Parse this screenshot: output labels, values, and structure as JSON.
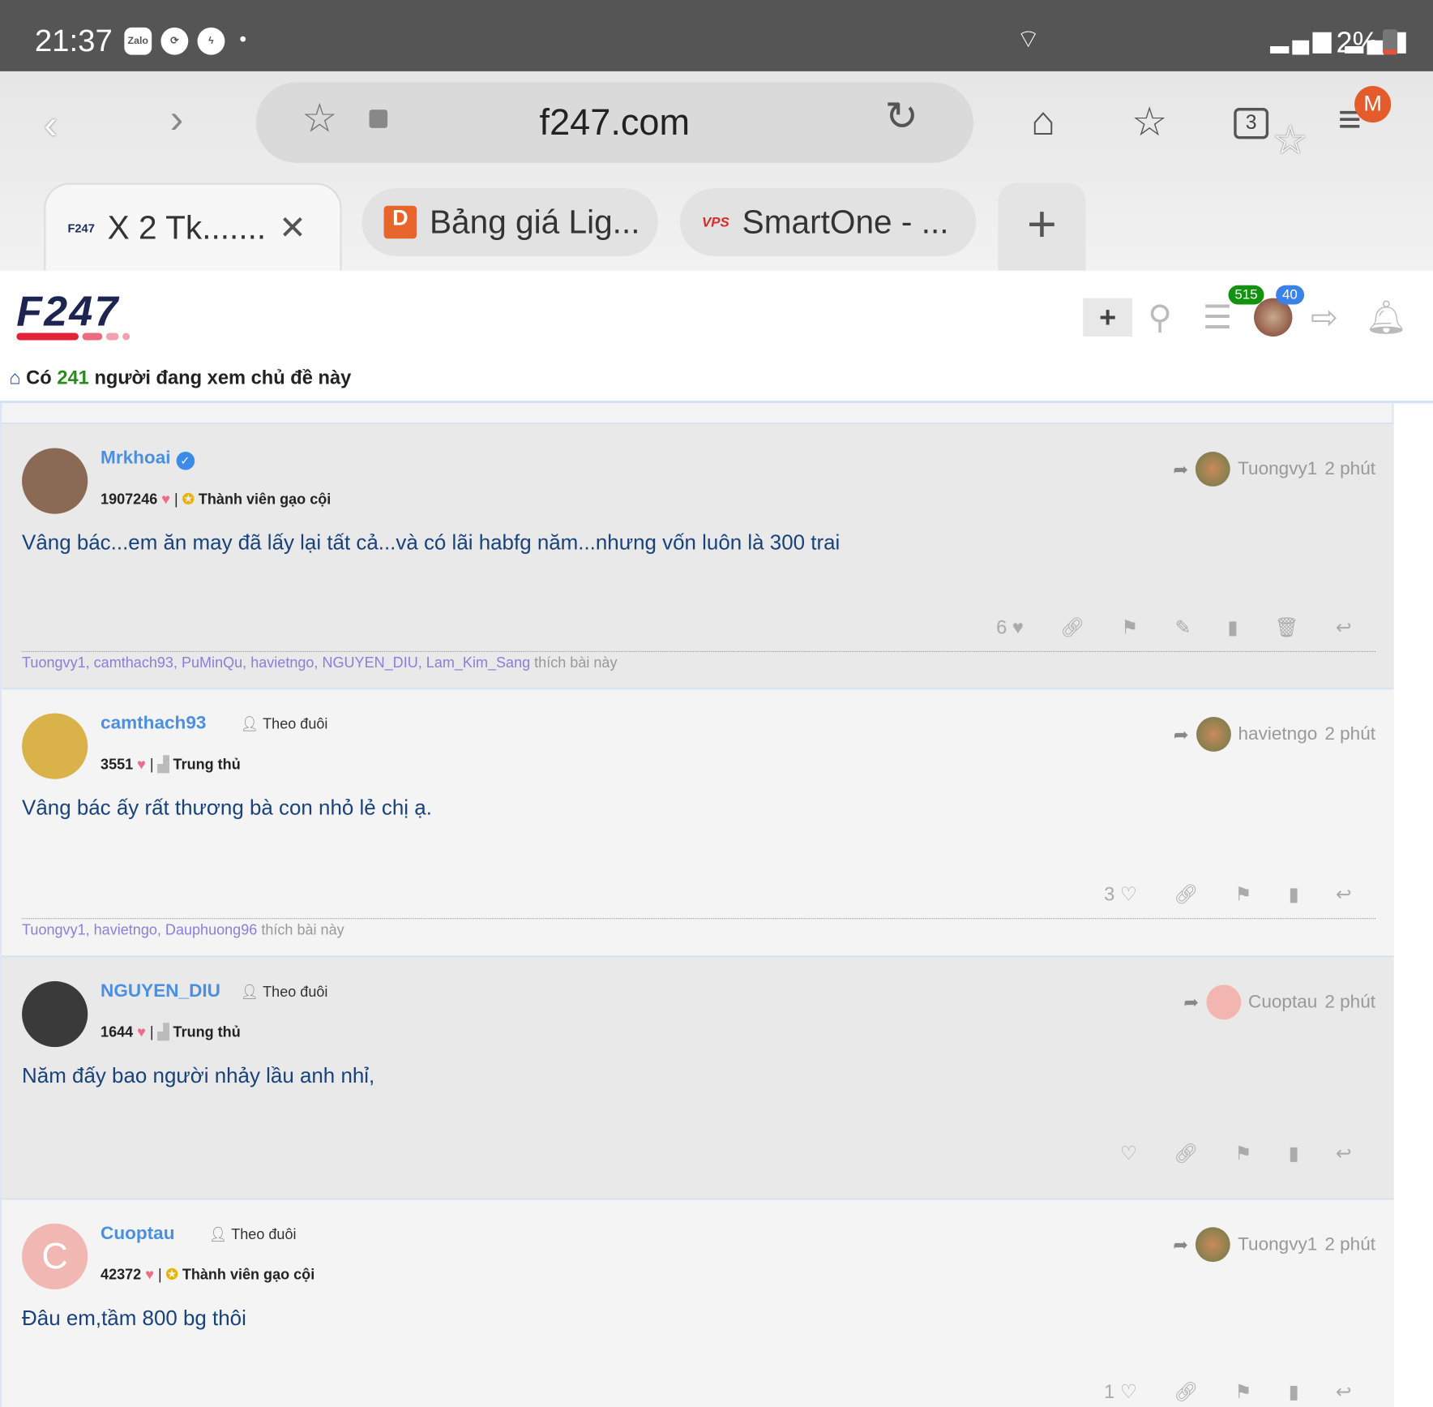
{
  "status_bar": {
    "time": "21:37",
    "apps": [
      "Zalo",
      "sync",
      "messenger"
    ],
    "battery": "2%"
  },
  "browser": {
    "url": "f247.com",
    "tab_count": "3",
    "profile_initial": "M",
    "tabs": [
      {
        "label": "X 2 Tk.......",
        "favicon": "F247"
      },
      {
        "label": "Bảng giá Lig...",
        "favicon": "D"
      },
      {
        "label": "SmartOne - ...",
        "favicon": "VPS"
      }
    ]
  },
  "site": {
    "logo": "F247",
    "badge_green": "515",
    "badge_blue": "40",
    "notice": {
      "prefix": "Có",
      "count": "241",
      "suffix": "người đang xem chủ đề này"
    }
  },
  "posts": [
    {
      "user": "Mrkhoai",
      "verified": true,
      "follow": "",
      "score": "1907246",
      "rank": "Thành viên gạo cội",
      "rank_icon": "award",
      "text": "Vâng bác...em ăn may đã lấy lại tất cả...và có lãi habfg năm...nhưng vốn luôn là 300 trai",
      "reply_to": "Tuongvy1",
      "time": "2 phút",
      "like_count": "6",
      "liked": true,
      "actions": [
        "link",
        "flag",
        "edit",
        "bookmark",
        "delete",
        "reply"
      ],
      "likers": "Tuongvy1, camthach93, PuMinQu, havietngo, NGUYEN_DIU, Lam_Kim_Sang",
      "likers_suffix": "thích bài này",
      "bg": "#e9e9e9",
      "avatar_color": "#8a6a55"
    },
    {
      "user": "camthach93",
      "verified": false,
      "follow": "Theo đuôi",
      "score": "3551",
      "rank": "Trung thủ",
      "rank_icon": "users",
      "text": "Vâng bác ấy rất thương bà con nhỏ lẻ chị ạ.",
      "reply_to": "havietngo",
      "time": "2 phút",
      "like_count": "3",
      "liked": false,
      "actions": [
        "link",
        "flag",
        "bookmark",
        "reply"
      ],
      "likers": "Tuongvy1, havietngo, Dauphuong96",
      "likers_suffix": "thích bài này",
      "bg": "#f4f4f4",
      "avatar_color": "#d9b24a"
    },
    {
      "user": "NGUYEN_DIU",
      "verified": false,
      "follow": "Theo đuôi",
      "score": "1644",
      "rank": "Trung thủ",
      "rank_icon": "users",
      "text": "Năm đấy bao người nhảy lầu anh nhỉ,",
      "reply_to": "Cuoptau",
      "time": "2 phút",
      "like_count": "",
      "liked": false,
      "actions": [
        "link",
        "flag",
        "bookmark",
        "reply"
      ],
      "likers": "",
      "likers_suffix": "",
      "bg": "#e9e9e9",
      "avatar_color": "#3a3a3a"
    },
    {
      "user": "Cuoptau",
      "verified": false,
      "follow": "Theo đuôi",
      "score": "42372",
      "rank": "Thành viên gạo cội",
      "rank_icon": "award",
      "text": "Đâu em,tầm 800 bg thôi",
      "reply_to": "Tuongvy1",
      "time": "2 phút",
      "like_count": "1",
      "liked": false,
      "actions": [
        "link",
        "flag",
        "bookmark",
        "reply"
      ],
      "likers": "",
      "likers_suffix": "",
      "bg": "#f4f4f4",
      "avatar_color": "#f0b7b3",
      "avatar_letter": "C"
    }
  ]
}
